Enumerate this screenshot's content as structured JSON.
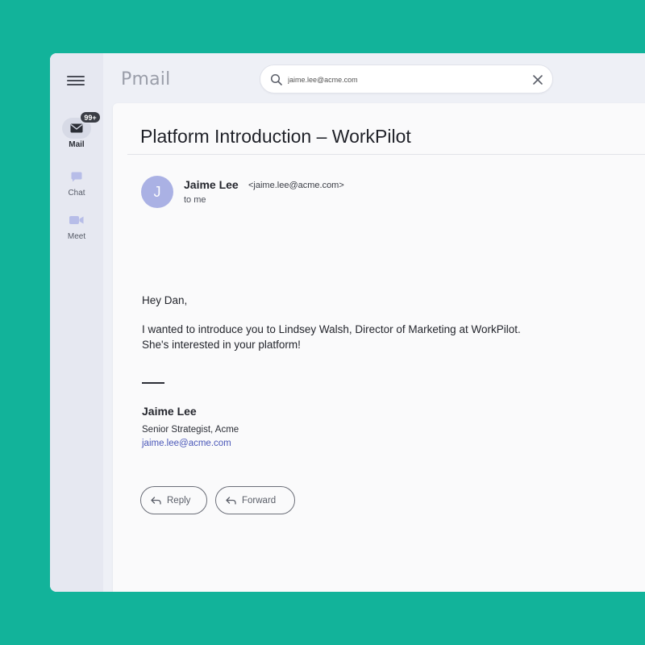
{
  "app": {
    "brand": "Pmail"
  },
  "sidebar": {
    "items": [
      {
        "label": "Mail",
        "badge": "99+",
        "icon": "mail-icon"
      },
      {
        "label": "Chat",
        "icon": "chat-icon"
      },
      {
        "label": "Meet",
        "icon": "video-icon"
      }
    ]
  },
  "search": {
    "value": "jaime.lee@acme.com"
  },
  "email": {
    "subject": "Platform Introduction – WorkPilot",
    "sender": {
      "initial": "J",
      "name": "Jaime Lee",
      "email": "<jaime.lee@acme.com>"
    },
    "recipient": "to me",
    "greeting": "Hey Dan,",
    "body_line1": "I wanted to introduce you to Lindsey Walsh, Director of Marketing at WorkPilot.",
    "body_line2": "She's interested in your platform!",
    "signature": {
      "name": "Jaime Lee",
      "title": "Senior Strategist, Acme",
      "email": "jaime.lee@acme.com"
    }
  },
  "actions": {
    "reply_label": "Reply",
    "forward_label": "Forward"
  },
  "colors": {
    "background": "#12b39a",
    "avatar": "#aab1e4",
    "link": "#4a57b8",
    "sidebar": "#e6e8f1"
  }
}
